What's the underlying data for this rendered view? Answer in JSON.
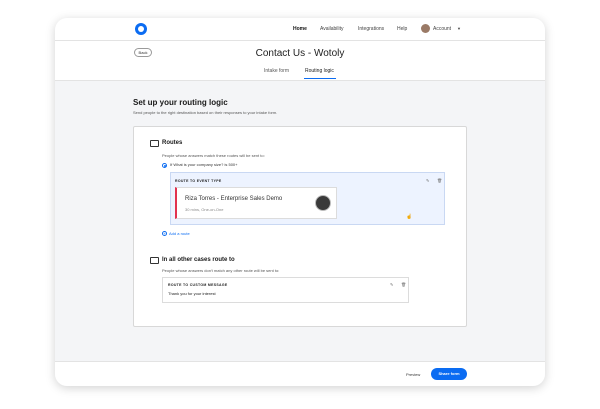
{
  "topnav": {
    "items": [
      {
        "label": "Home"
      },
      {
        "label": "Availability"
      },
      {
        "label": "Integrations"
      },
      {
        "label": "Help"
      }
    ],
    "account_label": "Account"
  },
  "header": {
    "back_label": "Back",
    "title": "Contact Us - Wotoly",
    "tabs": [
      {
        "label": "Intake form"
      },
      {
        "label": "Routing logic"
      }
    ],
    "active_tab": "Routing logic"
  },
  "main": {
    "title": "Set up your routing logic",
    "subtitle": "Send people to the right destination based on their responses to your intake form.",
    "routes": {
      "title": "Routes",
      "description": "People whose answers match these routes will be sent to:",
      "condition": "If What is your company size? is 500+",
      "route_label": "ROUTE TO EVENT TYPE",
      "event_name": "Riza Torres - Enterprise Sales Demo",
      "event_meta": "30 mins, One-on-One",
      "add_route_label": "Add a route"
    },
    "other_cases": {
      "title": "In all other cases route to",
      "description": "People whose answers don't match any other route will be sent to:",
      "route_label": "ROUTE TO CUSTOM MESSAGE",
      "message": "Thank you for your interest"
    }
  },
  "footer": {
    "preview_label": "Preview",
    "share_label": "Share form"
  },
  "colors": {
    "primary": "#0b6cf2",
    "event_accent": "#e2324f",
    "route_bg": "#edf3ff"
  },
  "icons": [
    "logo-icon",
    "chevron-down-icon",
    "routes-icon",
    "edit-icon",
    "delete-icon",
    "plus-circle-icon",
    "cursor-icon"
  ]
}
